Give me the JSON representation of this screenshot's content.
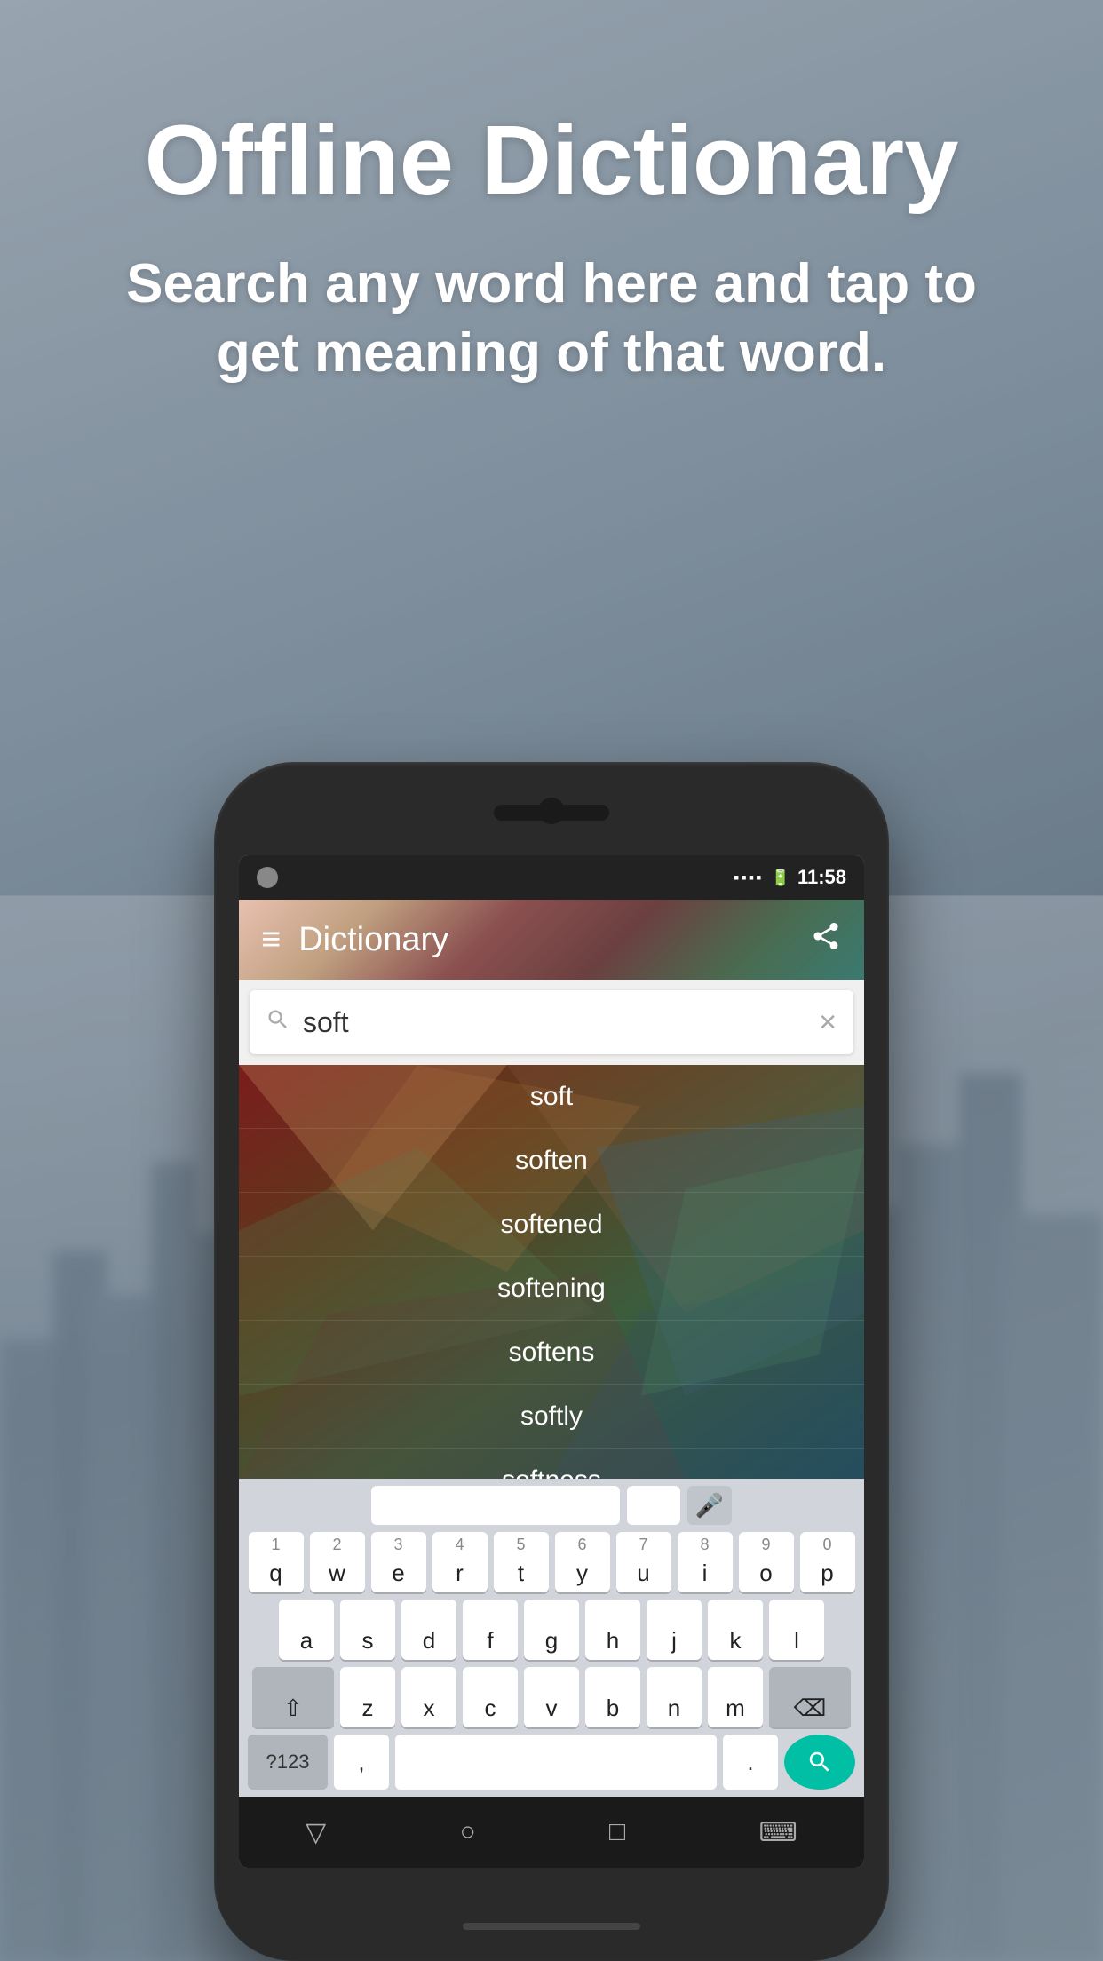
{
  "page": {
    "title": "Offline Dictionary",
    "subtitle": "Search any word here and tap to get meaning of that word."
  },
  "statusBar": {
    "time": "11:58",
    "batteryIcon": "🔋",
    "signalIcon": "📶"
  },
  "appBar": {
    "title": "Dictionary",
    "menuLabel": "≡",
    "shareLabel": "⎘"
  },
  "searchBar": {
    "placeholder": "soft",
    "query": "soft",
    "clearIcon": "✕"
  },
  "results": [
    {
      "word": "soft"
    },
    {
      "word": "soften"
    },
    {
      "word": "softened"
    },
    {
      "word": "softening"
    },
    {
      "word": "softens"
    },
    {
      "word": "softly"
    },
    {
      "word": "softness"
    }
  ],
  "keyboard": {
    "rows": [
      [
        "q",
        "w",
        "e",
        "r",
        "t",
        "y",
        "u",
        "i",
        "o",
        "p"
      ],
      [
        "a",
        "s",
        "d",
        "f",
        "g",
        "h",
        "j",
        "k",
        "l"
      ],
      [
        "z",
        "x",
        "c",
        "v",
        "b",
        "n",
        "m"
      ]
    ],
    "numbers": [
      [
        "1",
        "2",
        "3",
        "4",
        "5",
        "6",
        "7",
        "8",
        "9",
        "0"
      ],
      [
        null,
        null,
        null,
        null,
        null,
        null,
        null,
        null,
        null
      ],
      [
        null,
        null,
        null,
        null,
        null,
        null,
        null
      ]
    ],
    "specialKeys": {
      "shift": "⇧",
      "backspace": "⌫",
      "sym": "?123",
      "comma": ",",
      "period": ".",
      "searchBtn": "🔍"
    }
  },
  "navBar": {
    "backBtn": "▽",
    "homeBtn": "○",
    "recentBtn": "□",
    "keyboardBtn": "⌨"
  },
  "colors": {
    "appBarGradient": "#8b3535",
    "accent": "#00bfa5",
    "resultsBg": "#7a2020",
    "textWhite": "#ffffff"
  }
}
